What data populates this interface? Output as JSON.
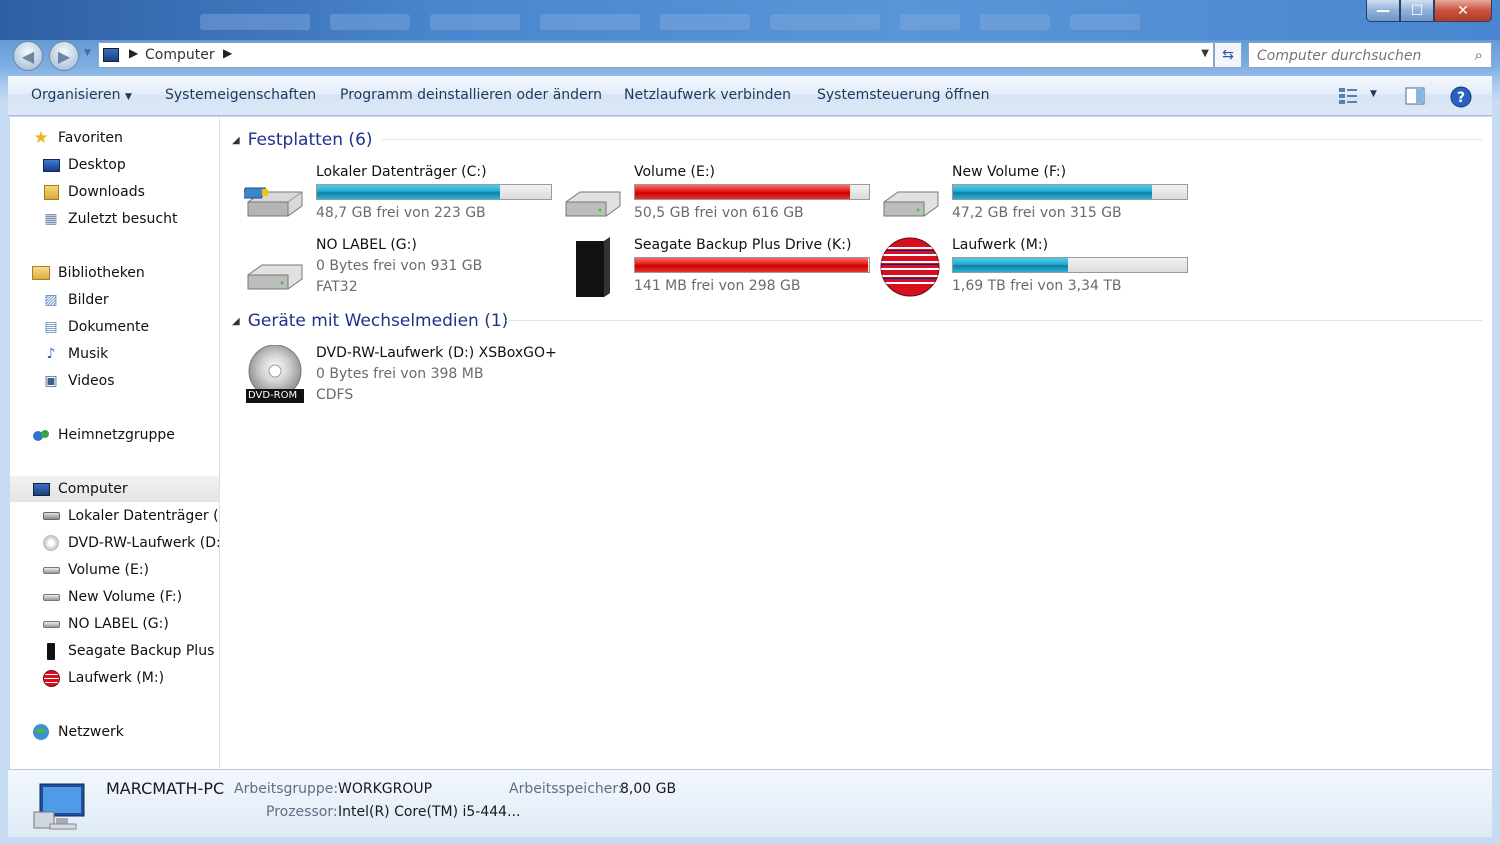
{
  "window": {
    "close_label": "✕",
    "max_label": "☐",
    "min_label": "—"
  },
  "address": {
    "crumb": "Computer",
    "search_placeholder": "Computer durchsuchen"
  },
  "toolbar": {
    "organize": "Organisieren",
    "items": [
      "Systemeigenschaften",
      "Programm deinstallieren oder ändern",
      "Netzlaufwerk verbinden",
      "Systemsteuerung öffnen"
    ]
  },
  "nav": {
    "favorites": "Favoriten",
    "fav_items": [
      "Desktop",
      "Downloads",
      "Zuletzt besucht"
    ],
    "libraries": "Bibliotheken",
    "lib_items": [
      "Bilder",
      "Dokumente",
      "Musik",
      "Videos"
    ],
    "homegroup": "Heimnetzgruppe",
    "computer": "Computer",
    "computer_items": [
      "Lokaler Datenträger (C:)",
      "DVD-RW-Laufwerk (D:)",
      "Volume (E:)",
      "New Volume (F:)",
      "NO LABEL (G:)",
      "Seagate Backup Plus Drive (K:)",
      "Laufwerk (M:)"
    ],
    "network": "Netzwerk"
  },
  "groups": {
    "hdd": "Festplatten (6)",
    "removable": "Geräte mit Wechselmedien (1)"
  },
  "drives": [
    {
      "name": "Lokaler Datenträger (C:)",
      "free": "48,7 GB frei von 223 GB",
      "used_fraction": 0.78,
      "color": "blue"
    },
    {
      "name": "Volume (E:)",
      "free": "50,5 GB frei von 616 GB",
      "used_fraction": 0.92,
      "color": "red"
    },
    {
      "name": "New Volume (F:)",
      "free": "47,2 GB frei von 315 GB",
      "used_fraction": 0.85,
      "color": "blue"
    },
    {
      "name": "NO LABEL (G:)",
      "free": "0 Bytes frei von 931 GB",
      "fs": "FAT32"
    },
    {
      "name": "Seagate Backup Plus Drive (K:)",
      "free": "141 MB frei von 298 GB",
      "used_fraction": 0.995,
      "color": "red"
    },
    {
      "name": "Laufwerk (M:)",
      "free": "1,69 TB frei von 3,34 TB",
      "used_fraction": 0.49,
      "color": "blue"
    }
  ],
  "removable": [
    {
      "name": "DVD-RW-Laufwerk (D:) XSBoxGO+",
      "free": "0 Bytes frei von 398 MB",
      "fs": "CDFS",
      "badge": "DVD-ROM"
    }
  ],
  "details": {
    "pc_name": "MARCMATH-PC",
    "workgroup_label": "Arbeitsgruppe:",
    "workgroup": "WORKGROUP",
    "memory_label": "Arbeitsspeicher:",
    "memory": "8,00 GB",
    "cpu_label": "Prozessor:",
    "cpu": "Intel(R) Core(TM) i5-444..."
  },
  "colors": {
    "accent": "#1e3287",
    "bar_blue": "#26a8d0",
    "bar_red": "#e01818"
  }
}
